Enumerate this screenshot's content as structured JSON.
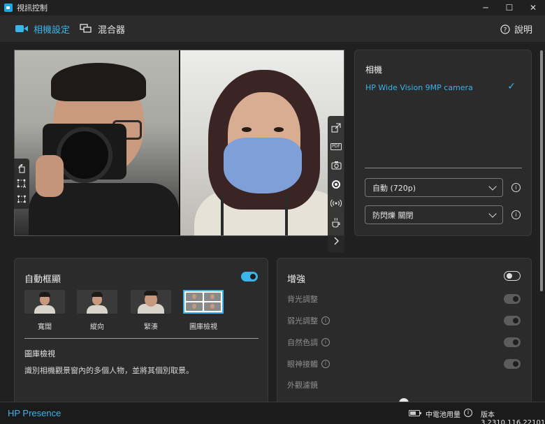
{
  "window": {
    "title": "視訊控制",
    "minimize": "─",
    "maximize": "☐",
    "close": "✕"
  },
  "nav": {
    "tabs": [
      {
        "label": "相機設定",
        "icon": "camera-icon",
        "active": true
      },
      {
        "label": "混合器",
        "icon": "mixer-icon",
        "active": false
      }
    ],
    "help_label": "說明",
    "accent": "#3bb4ea"
  },
  "preview": {
    "left_tools": [
      "rotate-icon",
      "crop-icon",
      "multi-frame-icon"
    ],
    "right_tools": [
      "popout-icon",
      "pdf-icon",
      "snapshot-icon",
      "record-icon",
      "broadcast-icon",
      "coffee-icon",
      "expand-icon"
    ],
    "pdf_text": "PDF"
  },
  "camera_panel": {
    "heading": "相機",
    "selected_camera": "HP Wide Vision 9MP camera",
    "resolution": "自動 (720p)",
    "anti_flicker": "防閃爍 關閉"
  },
  "auto_frame": {
    "heading": "自動框顯",
    "enabled": true,
    "modes": [
      {
        "label": "寬闊",
        "selected": false
      },
      {
        "label": "縱向",
        "selected": false
      },
      {
        "label": "緊湊",
        "selected": false
      },
      {
        "label": "圖庫檢視",
        "selected": true
      }
    ],
    "selected_mode_title": "圖庫檢視",
    "selected_mode_desc": "識別相機觀景窗內的多個人物，並將其個別取景。"
  },
  "enhance": {
    "heading": "增強",
    "enabled": false,
    "options": [
      {
        "label": "背光調整",
        "info": false
      },
      {
        "label": "弱光調整",
        "info": true
      },
      {
        "label": "自然色調",
        "info": true
      },
      {
        "label": "眼神接觸",
        "info": true
      }
    ],
    "filter_label": "外觀濾鏡"
  },
  "status": {
    "brand": "HP Presence",
    "battery_label": "中電池用量",
    "version": "版本 3.2310.116.22101"
  }
}
